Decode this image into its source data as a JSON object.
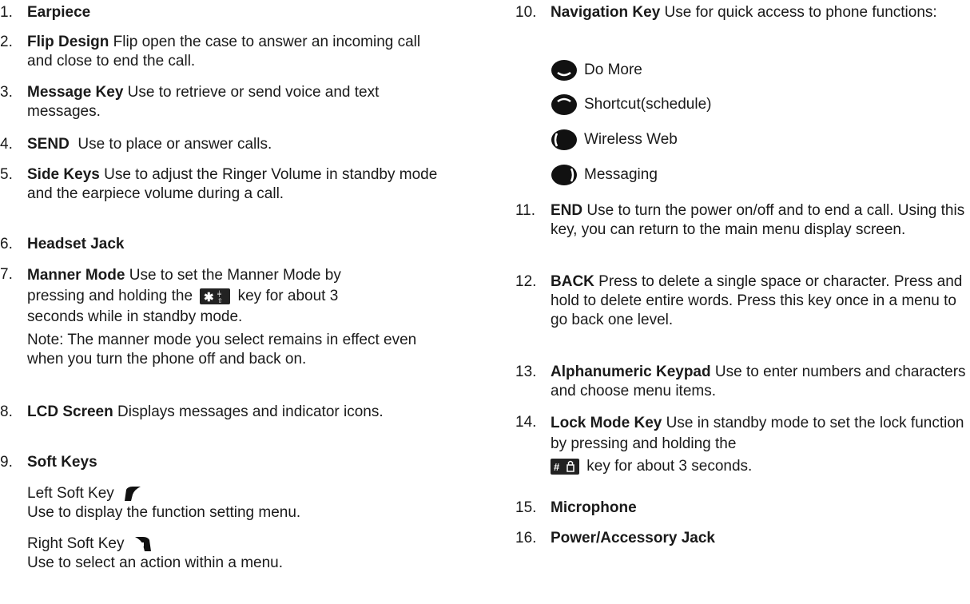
{
  "left": {
    "items": [
      {
        "num": "1.",
        "title": "Earpiece",
        "desc": ""
      },
      {
        "num": "2.",
        "title": "Flip Design",
        "desc": " Flip open the case to answer an incoming call and close to end the call."
      },
      {
        "num": "3.",
        "title": "Message Key",
        "desc": " Use to retrieve or send voice and text messages."
      },
      {
        "num": "4.",
        "title": "SEND",
        "desc": "  Use to place or answer calls."
      },
      {
        "num": "5.",
        "title": "Side Keys",
        "desc": " Use to adjust the Ringer Volume in standby mode and the earpiece volume during a call."
      },
      {
        "num": "6.",
        "title": "Headset Jack",
        "desc": ""
      },
      {
        "num": "7.",
        "title": "Manner Mode",
        "desc": " Use to set the Manner Mode by",
        "desc2": "pressing and holding the",
        "desc3": " key for about 3",
        "desc4": "seconds while in standby mode.",
        "icon": "star-vibrate-key-icon"
      },
      {
        "num": "8.",
        "title": "LCD Screen",
        "desc": " Displays messages and indicator icons."
      },
      {
        "num": "9.",
        "title": "Soft Keys",
        "desc": ""
      }
    ],
    "note": "Note: The manner mode you select remains in effect even when you turn the phone off and back on.",
    "left_soft_key_label": "Left Soft Key",
    "left_soft_key_desc": "Use to display the function setting menu.",
    "right_soft_key_label": "Right Soft Key",
    "right_soft_key_desc": "Use to select an action within a menu."
  },
  "right": {
    "nav": {
      "num": "10.",
      "title": "Navigation Key",
      "desc": " Use for quick access to phone functions:"
    },
    "nav_options": [
      {
        "label": "Do More",
        "icon": "nav-down-icon"
      },
      {
        "label": "Shortcut(schedule)",
        "icon": "nav-up-icon"
      },
      {
        "label": "Wireless Web",
        "icon": "nav-left-icon"
      },
      {
        "label": "Messaging",
        "icon": "nav-right-icon"
      }
    ],
    "items": [
      {
        "num": "11.",
        "title": "END",
        "desc": " Use to turn the power on/off and to end a call. Using this key, you can return to the main menu display screen."
      },
      {
        "num": "12.",
        "title": "BACK",
        "desc": " Press to delete a single space or character. Press and hold to delete entire words. Press this key once in a menu to go back one level."
      },
      {
        "num": "13.",
        "title": "Alphanumeric Keypad",
        "desc": " Use to enter numbers and characters and choose menu items."
      },
      {
        "num": "14.",
        "title": "Lock Mode Key",
        "desc": " Use in standby mode to set the lock function by pressing and holding the",
        "desc2": " key for about 3 seconds.",
        "icon": "pound-lock-key-icon"
      },
      {
        "num": "15.",
        "title": "Microphone",
        "desc": ""
      },
      {
        "num": "16.",
        "title": "Power/Accessory Jack",
        "desc": ""
      }
    ]
  }
}
